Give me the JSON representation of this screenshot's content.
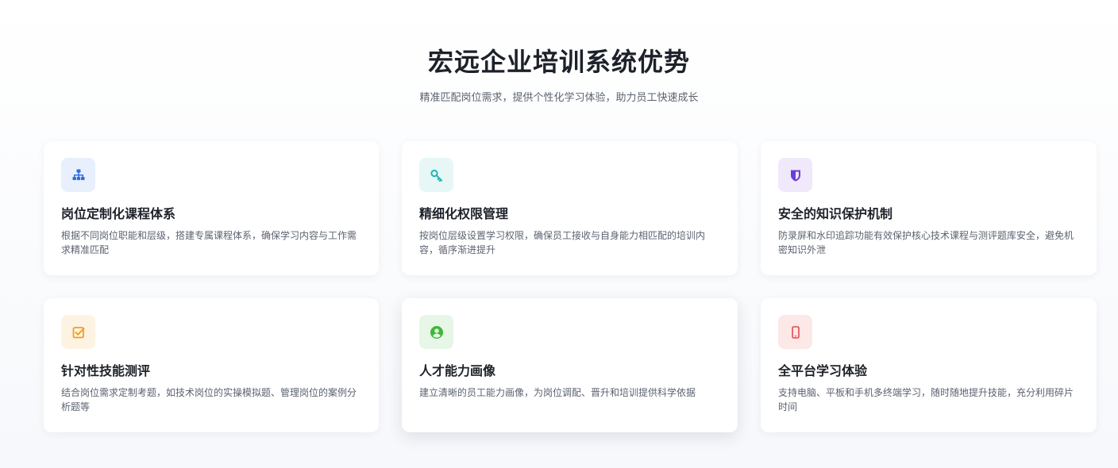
{
  "header": {
    "title": "宏远企业培训系统优势",
    "subtitle": "精准匹配岗位需求，提供个性化学习体验，助力员工快速成长"
  },
  "features": [
    {
      "title": "岗位定制化课程体系",
      "description": "根据不同岗位职能和层级，搭建专属课程体系，确保学习内容与工作需求精准匹配",
      "icon": "sitemap-icon",
      "icon_color": "#2f6bdc",
      "icon_bg": "#e8effd"
    },
    {
      "title": "精细化权限管理",
      "description": "按岗位层级设置学习权限，确保员工接收与自身能力相匹配的培训内容，循序渐进提升",
      "icon": "key-icon",
      "icon_color": "#1fb5b0",
      "icon_bg": "#e6f7f6"
    },
    {
      "title": "安全的知识保护机制",
      "description": "防录屏和水印追踪功能有效保护核心技术课程与测评题库安全，避免机密知识外泄",
      "icon": "shield-icon",
      "icon_color": "#6b3fd6",
      "icon_bg": "#efe9fb"
    },
    {
      "title": "针对性技能测评",
      "description": "结合岗位需求定制考题，如技术岗位的实操模拟题、管理岗位的案例分析题等",
      "icon": "check-square-icon",
      "icon_color": "#f0a020",
      "icon_bg": "#fdf3e2"
    },
    {
      "title": "人才能力画像",
      "description": "建立清晰的员工能力画像，为岗位调配、晋升和培训提供科学依据",
      "icon": "user-circle-icon",
      "icon_color": "#3db83a",
      "icon_bg": "#e7f6e6"
    },
    {
      "title": "全平台学习体验",
      "description": "支持电脑、平板和手机多终端学习，随时随地提升技能，充分利用碎片时间",
      "icon": "mobile-icon",
      "icon_color": "#e5484d",
      "icon_bg": "#fde8e8"
    }
  ]
}
